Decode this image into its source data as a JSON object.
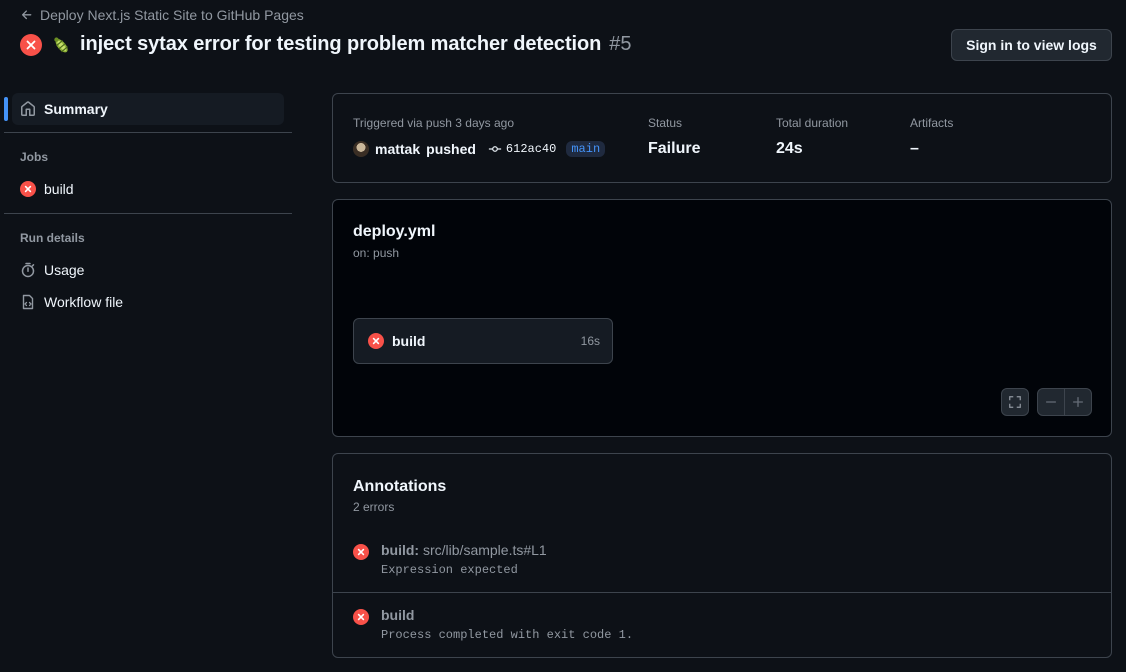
{
  "header": {
    "back_label": "Deploy Next.js Static Site to GitHub Pages",
    "title": "inject sytax error for testing problem matcher detection",
    "run_number": "#5",
    "sign_in_label": "Sign in to view logs"
  },
  "sidebar": {
    "summary_label": "Summary",
    "jobs_heading": "Jobs",
    "jobs": [
      {
        "label": "build",
        "status": "failure"
      }
    ],
    "run_details_heading": "Run details",
    "usage_label": "Usage",
    "workflow_file_label": "Workflow file"
  },
  "info": {
    "trigger_label": "Triggered via push 3 days ago",
    "actor": "mattak",
    "action": "pushed",
    "commit": "612ac40",
    "branch": "main",
    "status_label": "Status",
    "status_value": "Failure",
    "duration_label": "Total duration",
    "duration_value": "24s",
    "artifacts_label": "Artifacts",
    "artifacts_value": "–"
  },
  "workflow": {
    "file": "deploy.yml",
    "trigger": "on: push",
    "job": {
      "name": "build",
      "duration": "16s"
    }
  },
  "annotations": {
    "title": "Annotations",
    "count": "2 errors",
    "items": [
      {
        "job": "build:",
        "location": "src/lib/sample.ts#L1",
        "message": "Expression expected"
      },
      {
        "job": "build",
        "location": "",
        "message": "Process completed with exit code 1."
      }
    ]
  },
  "colors": {
    "background": "#0d1117",
    "error": "#f85149",
    "accent": "#4493f8",
    "border": "#3d444d"
  }
}
